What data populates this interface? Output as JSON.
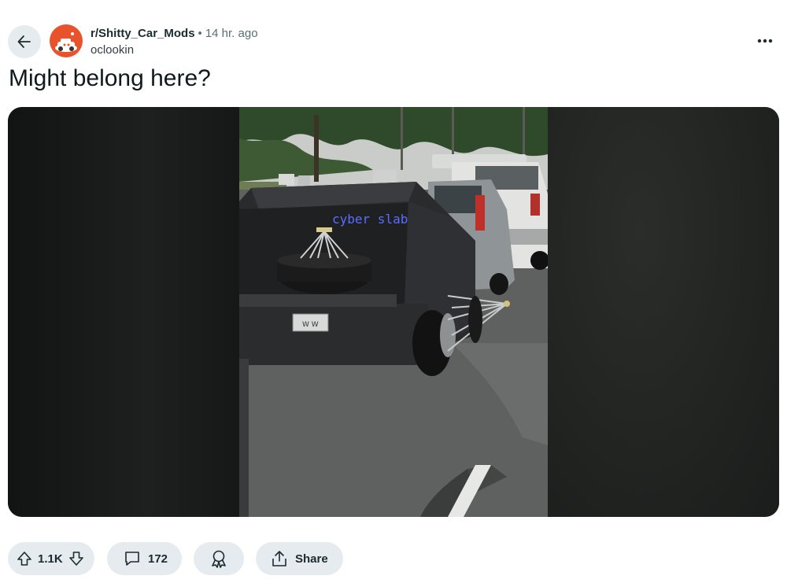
{
  "post": {
    "subreddit": "r/Shitty_Car_Mods",
    "separator": "•",
    "time_ago": "14 hr. ago",
    "author": "oclookin",
    "title": "Might belong here?"
  },
  "media": {
    "tailgate_sign": "cyber slab",
    "plate_text": "W W",
    "colors": {
      "blur": "#1c1e1e",
      "road": "#5f6161",
      "sign": "#3f5bff"
    }
  },
  "actions": {
    "upvotes": "1.1K",
    "comments": "172",
    "share_label": "Share"
  },
  "icons": [
    "back-arrow-icon",
    "subreddit-avatar",
    "more-options-icon",
    "upvote-icon",
    "downvote-icon",
    "comment-icon",
    "award-icon",
    "share-icon"
  ]
}
